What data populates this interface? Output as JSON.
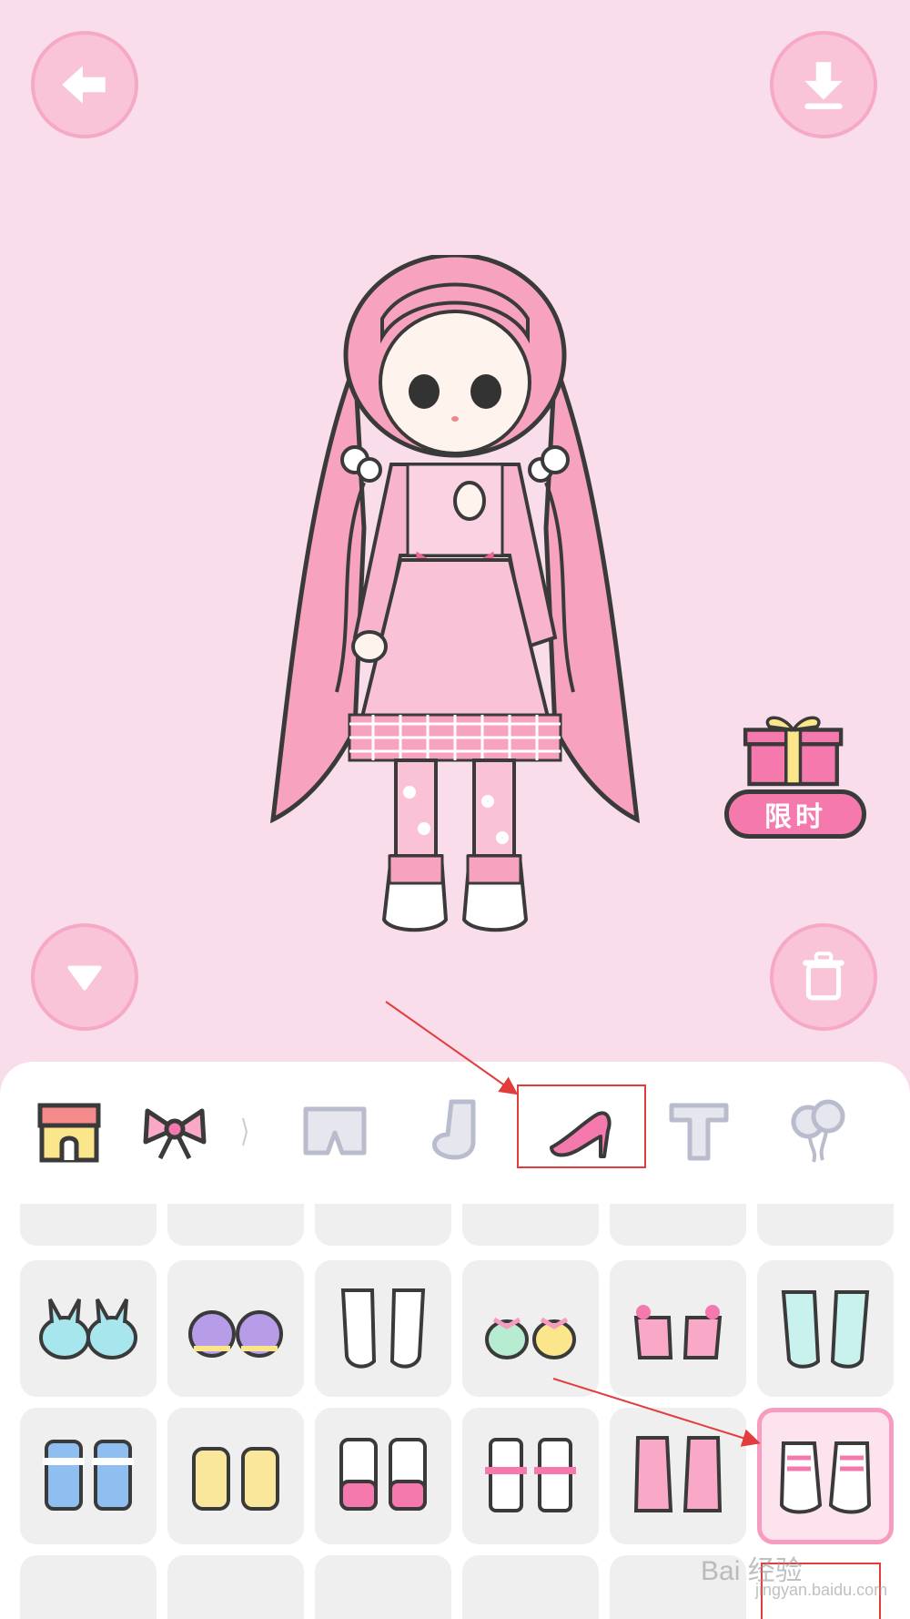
{
  "gift": {
    "label": "限时"
  },
  "tabs": [
    {
      "name": "shop",
      "icon": "shop-icon"
    },
    {
      "name": "bow",
      "icon": "bow-icon"
    },
    {
      "name": "pants",
      "icon": "pants-icon"
    },
    {
      "name": "socks",
      "icon": "sock-icon"
    },
    {
      "name": "shoes",
      "icon": "high-heel-icon",
      "selected": true
    },
    {
      "name": "text",
      "icon": "text-icon"
    },
    {
      "name": "balloons",
      "icon": "balloon-icon"
    }
  ],
  "shoe_items": {
    "row1": [
      "bunny-slippers-blue",
      "purple-shoes",
      "white-paw-socks",
      "fruit-pom-shoes",
      "pink-star-shoes",
      "mint-socks"
    ],
    "row2": [
      "blue-bow-boots",
      "yellow-bow-boots",
      "pink-frill-boots",
      "ribbon-sandals",
      "pink-lace-boots",
      "pink-sneakers"
    ]
  },
  "selected_item": "pink-sneakers",
  "watermark": {
    "main": "Bai 经验",
    "sub": "jingyan.baidu.com"
  },
  "colors": {
    "accent": "#f579ad",
    "button": "#f9c4d8",
    "highlight": "#e23c3c"
  }
}
